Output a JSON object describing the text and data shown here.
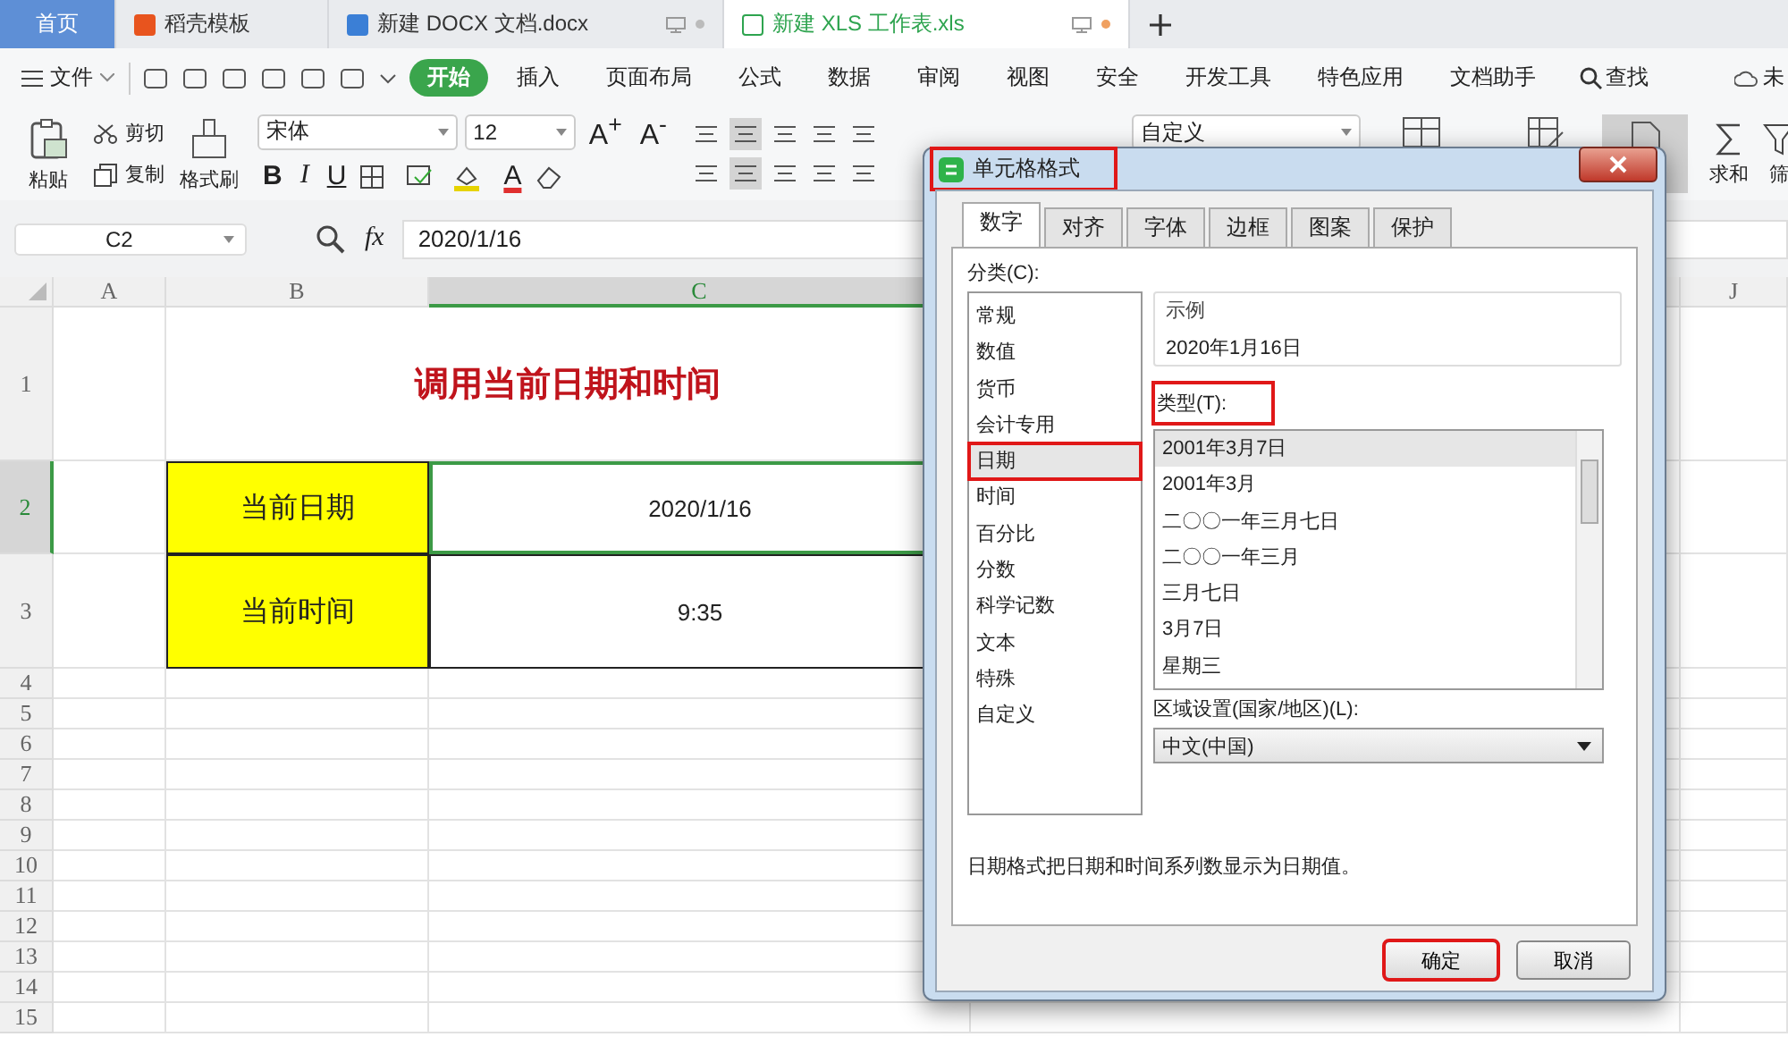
{
  "doc_tabs": [
    {
      "label": "首页",
      "kind": "home",
      "selected": false
    },
    {
      "label": "稻壳模板",
      "kind": "docer",
      "selected": false
    },
    {
      "label": "新建 DOCX 文档.docx",
      "kind": "word",
      "selected": false
    },
    {
      "label": "新建 XLS 工作表.xls",
      "kind": "sheet",
      "selected": true
    }
  ],
  "menu": {
    "file": "文件",
    "tabs": [
      {
        "label": "开始",
        "selected": true
      },
      {
        "label": "插入",
        "selected": false
      },
      {
        "label": "页面布局",
        "selected": false
      },
      {
        "label": "公式",
        "selected": false
      },
      {
        "label": "数据",
        "selected": false
      },
      {
        "label": "审阅",
        "selected": false
      },
      {
        "label": "视图",
        "selected": false
      },
      {
        "label": "安全",
        "selected": false
      },
      {
        "label": "开发工具",
        "selected": false
      },
      {
        "label": "特色应用",
        "selected": false
      },
      {
        "label": "文档助手",
        "selected": false
      }
    ],
    "search": "查找",
    "sync": "未"
  },
  "ribbon": {
    "paste": "粘贴",
    "cut": "剪切",
    "copy": "复制",
    "format_painter": "格式刷",
    "font": "宋体",
    "size": "12",
    "size_buttons": [
      "A$^{+}$",
      "A$^{-}$"
    ],
    "styles": [
      "B",
      "I",
      "U"
    ],
    "font_color": "A",
    "number_format": "自定义",
    "sum": "求和",
    "filter": "筛"
  },
  "formula_bar": {
    "cell": "C2",
    "fx": "fx",
    "value": "2020/1/16"
  },
  "sheet": {
    "columns": [
      {
        "label": "A",
        "selected": false
      },
      {
        "label": "B",
        "selected": false
      },
      {
        "label": "C",
        "selected": true
      },
      {
        "label": "J",
        "selected": false
      }
    ],
    "rows": [
      {
        "number": "1",
        "selected": false,
        "cells": [
          {
            "kind": "title",
            "text": "调用当前日期和时间"
          }
        ]
      },
      {
        "number": "2",
        "selected": true,
        "cells": [
          {
            "kind": "label",
            "text": "当前日期"
          },
          {
            "kind": "value",
            "text": "2020/1/16",
            "selected": true
          }
        ]
      },
      {
        "number": "3",
        "selected": false,
        "cells": [
          {
            "kind": "label",
            "text": "当前时间"
          },
          {
            "kind": "value",
            "text": "9:35",
            "selected": false
          }
        ]
      },
      {
        "number": "4",
        "selected": false
      },
      {
        "number": "5",
        "selected": false
      },
      {
        "number": "6",
        "selected": false
      },
      {
        "number": "7",
        "selected": false
      },
      {
        "number": "8",
        "selected": false
      },
      {
        "number": "9",
        "selected": false
      },
      {
        "number": "10",
        "selected": false
      },
      {
        "number": "11",
        "selected": false
      },
      {
        "number": "12",
        "selected": false
      },
      {
        "number": "13",
        "selected": false
      },
      {
        "number": "14",
        "selected": false
      },
      {
        "number": "15",
        "selected": false
      }
    ]
  },
  "dialog": {
    "title": "单元格格式",
    "title_highlighted": true,
    "tabs": [
      {
        "label": "数字",
        "selected": true
      },
      {
        "label": "对齐",
        "selected": false
      },
      {
        "label": "字体",
        "selected": false
      },
      {
        "label": "边框",
        "selected": false
      },
      {
        "label": "图案",
        "selected": false
      },
      {
        "label": "保护",
        "selected": false
      }
    ],
    "category_label": "分类(C):",
    "categories": [
      {
        "label": "常规",
        "selected": false,
        "highlighted": false
      },
      {
        "label": "数值",
        "selected": false,
        "highlighted": false
      },
      {
        "label": "货币",
        "selected": false,
        "highlighted": false
      },
      {
        "label": "会计专用",
        "selected": false,
        "highlighted": false
      },
      {
        "label": "日期",
        "selected": true,
        "highlighted": true
      },
      {
        "label": "时间",
        "selected": false,
        "highlighted": false
      },
      {
        "label": "百分比",
        "selected": false,
        "highlighted": false
      },
      {
        "label": "分数",
        "selected": false,
        "highlighted": false
      },
      {
        "label": "科学记数",
        "selected": false,
        "highlighted": false
      },
      {
        "label": "文本",
        "selected": false,
        "highlighted": false
      },
      {
        "label": "特殊",
        "selected": false,
        "highlighted": false
      },
      {
        "label": "自定义",
        "selected": false,
        "highlighted": false
      }
    ],
    "sample_label": "示例",
    "sample": "2020年1月16日",
    "type_label": "类型(T):",
    "type_label_highlighted": true,
    "types": [
      {
        "label": "2001年3月7日",
        "selected": true
      },
      {
        "label": "2001年3月",
        "selected": false
      },
      {
        "label": "二〇〇一年三月七日",
        "selected": false
      },
      {
        "label": "二〇〇一年三月",
        "selected": false
      },
      {
        "label": "三月七日",
        "selected": false
      },
      {
        "label": "3月7日",
        "selected": false
      },
      {
        "label": "星期三",
        "selected": false
      }
    ],
    "locale_label": "区域设置(国家/地区)(L):",
    "locale": "中文(中国)",
    "description": "日期格式把日期和时间系列数显示为日期值。",
    "buttons": [
      {
        "label": "确定",
        "highlighted": true
      },
      {
        "label": "取消",
        "highlighted": false
      }
    ]
  }
}
